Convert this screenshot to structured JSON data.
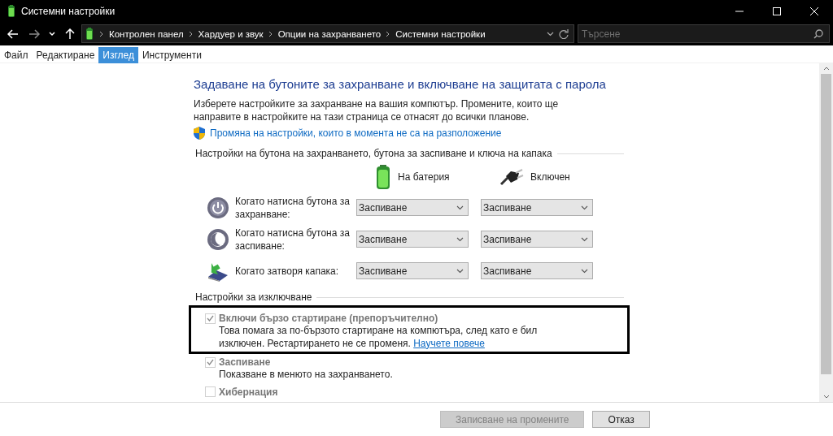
{
  "window": {
    "title": "Системни настройки"
  },
  "address_bar": {
    "breadcrumbs": [
      "Контролен панел",
      "Хардуер и звук",
      "Опции на захранването",
      "Системни настройки"
    ]
  },
  "search": {
    "placeholder": "Търсене"
  },
  "menu": [
    {
      "label": "Файл",
      "selected": false
    },
    {
      "label": "Редактиране",
      "selected": false
    },
    {
      "label": "Изглед",
      "selected": true
    },
    {
      "label": "Инструменти",
      "selected": false
    }
  ],
  "heading": "Задаване на бутоните за захранване и включване на защитата с парола",
  "description": "Изберете настройките за захранване на вашия компютър. Промените, които ще направите в настройките на тази страница се отнасят до всички планове.",
  "admin_link": "Промяна на настройки, които в момента не са на разположение",
  "buttons_section": {
    "title": "Настройки на бутона на захранването, бутона за заспиване и ключа на капака",
    "columns": [
      {
        "kind": "battery",
        "label": "На батерия"
      },
      {
        "kind": "plug",
        "label": "Включен"
      }
    ],
    "rows": [
      {
        "kind": "power",
        "label": "Когато натисна бутона за захранване:",
        "values": [
          "Заспиване",
          "Заспиване"
        ]
      },
      {
        "kind": "sleep",
        "label": "Когато натисна бутона за заспиване:",
        "values": [
          "Заспиване",
          "Заспиване"
        ]
      },
      {
        "kind": "lid",
        "label": "Когато затворя капака:",
        "values": [
          "Заспиване",
          "Заспиване"
        ]
      }
    ]
  },
  "shutdown_section": {
    "title": "Настройки за изключване",
    "options": [
      {
        "label": "Включи бързо стартиране (препоръчително)",
        "description": "Това помага за по-бързото стартиране на компютъра, след като е бил изключен. Рестартирането не се променя.",
        "link": "Научете повече",
        "checked": true,
        "disabled": true,
        "highlighted": true
      },
      {
        "label": "Заспиване",
        "description": "Показване в менюто на захранването.",
        "checked": true,
        "disabled": true,
        "highlighted": false
      },
      {
        "label": "Хибернация",
        "checked": false,
        "disabled": true,
        "highlighted": false
      }
    ]
  },
  "footer_buttons": [
    {
      "label": "Записване на промените",
      "disabled": true
    },
    {
      "label": "Отказ",
      "disabled": false
    }
  ]
}
